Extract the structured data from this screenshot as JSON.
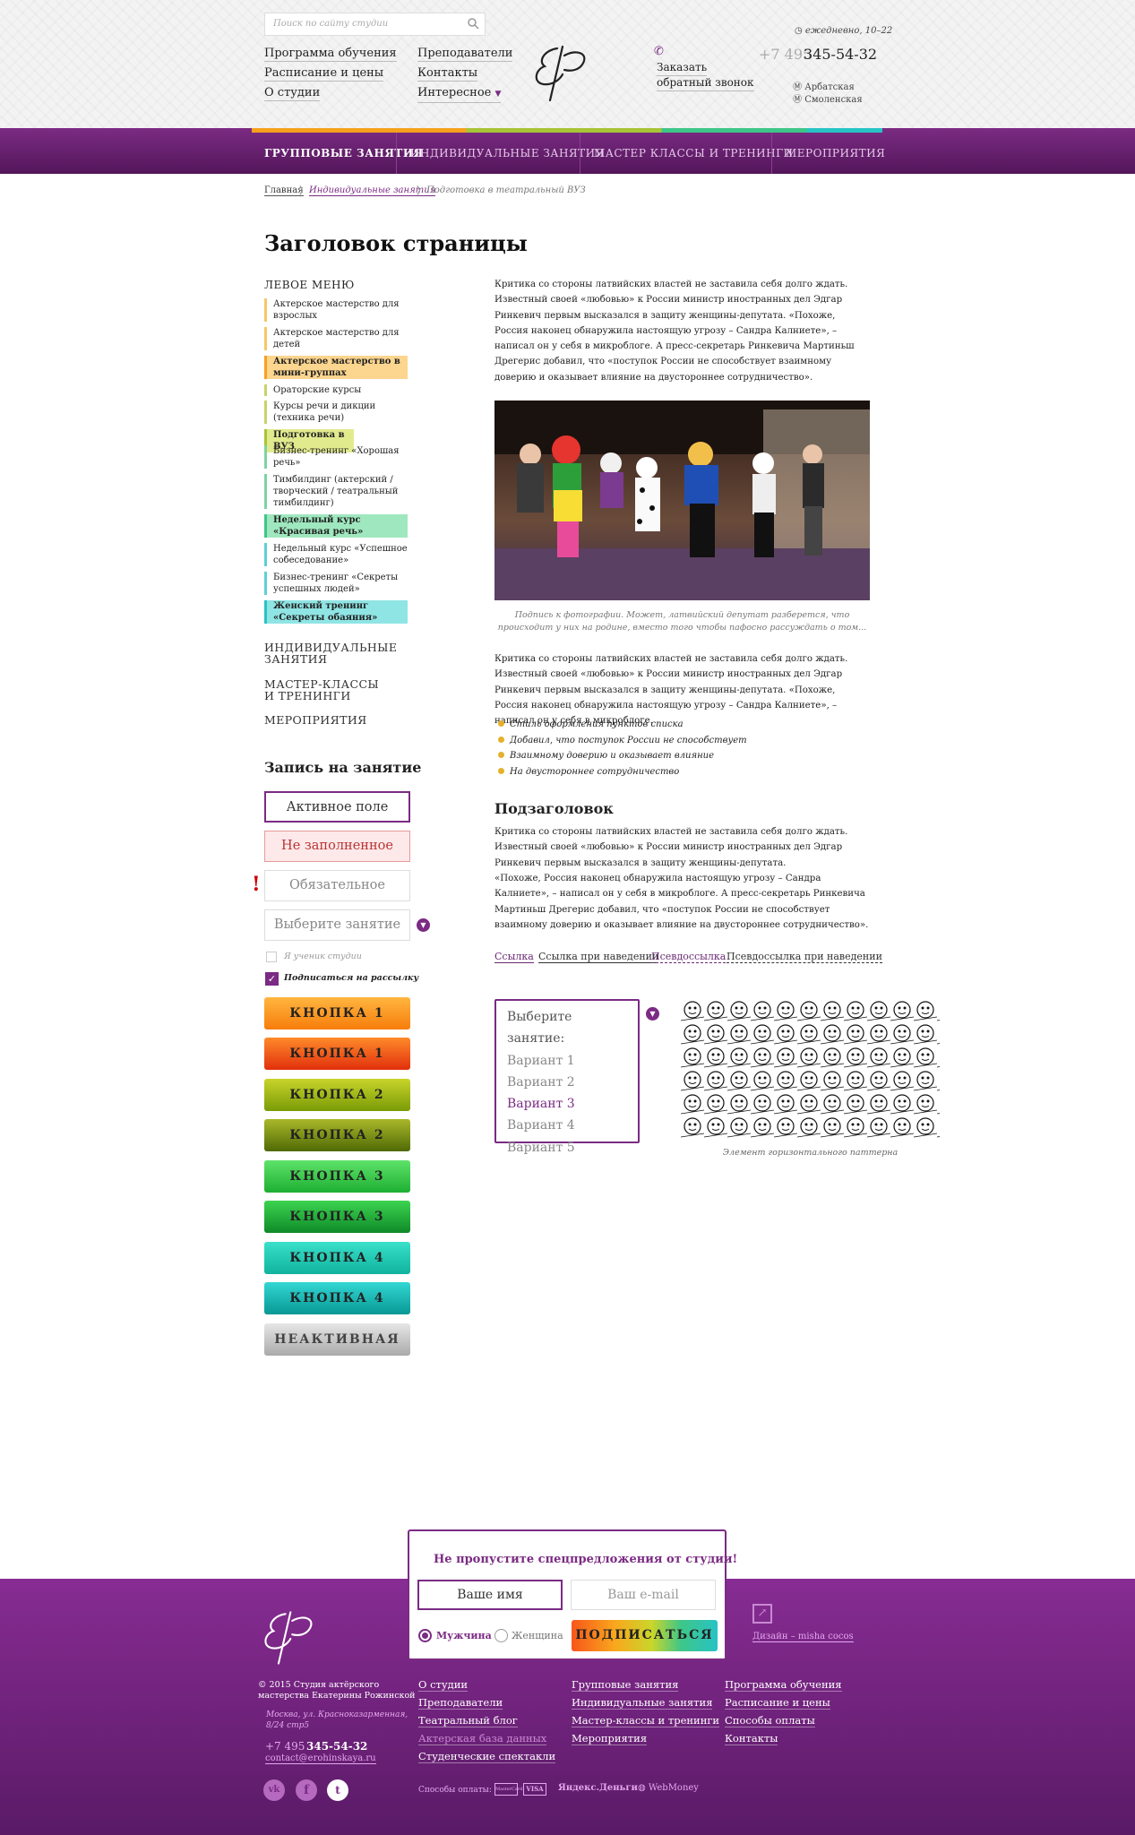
{
  "header": {
    "search_placeholder": "Поиск по сайту студии",
    "links_col1": [
      "Программа обучения",
      "Расписание и цены",
      "О студии"
    ],
    "links_col2": [
      "Преподаватели",
      "Контакты",
      "Интересное"
    ],
    "callback": [
      "Заказать",
      "обратный звонок"
    ],
    "hours": "ежедневно, 10–22",
    "phone_prefix": "+7 495",
    "phone": "345-54-32",
    "metro": [
      "Арбатская",
      "Смоленская"
    ]
  },
  "nav": {
    "items": [
      "Групповые занятия",
      "Индивидуальные занятия",
      "Мастер классы и тренинги",
      "Мероприятия"
    ]
  },
  "breadcrumb": [
    "Главная",
    "Индивидуальные занятия",
    "Подготовка в театральный ВУЗ"
  ],
  "page_title": "Заголовок страницы",
  "left_menu": {
    "title": "ЛЕВОЕ МЕНЮ",
    "items": [
      "Актерское мастерство для взрослых",
      "Актерское мастерство для детей",
      "Актерское мастерство в мини-группах",
      "Ораторские курсы",
      "Курсы речи и дикции (техника речи)",
      "Подготовка в ВУЗ",
      "Бизнес-тренинг «Хорошая речь»",
      "Тимбилдинг (актерский / творческий / театральный тимбилдинг)",
      "Недельный курс «Красивая речь»",
      "Недельный курс «Успешное собеседование»",
      "Бизнес-тренинг «Секреты успешных людей»",
      "Женский тренинг «Секреты обаяния»"
    ],
    "sections": [
      "ИНДИВИДУАЛЬНЫЕ ЗАНЯТИЯ",
      "МАСТЕР-КЛАССЫ И ТРЕНИНГИ",
      "МЕРОПРИЯТИЯ"
    ]
  },
  "form": {
    "title": "Запись на занятие",
    "active": "Активное поле",
    "empty": "Не заполненное",
    "required": "Обязательное",
    "select": "Выберите занятие",
    "check1": "Я ученик студии",
    "check2": "Подписаться на рассылку",
    "buttons": [
      "Кнопка 1",
      "Кнопка 1 roll",
      "Кнопка 2",
      "Кнопка 2 roll",
      "Кнопка 3",
      "Кнопка 3 roll",
      "Кнопка 4",
      "Кнопка 4 roll",
      "Неактивная"
    ]
  },
  "content": {
    "p1": "Критика со стороны латвийских властей не заставила себя долго ждать. Известный своей «любовью» к России министр иностранных дел Эдгар Ринкевич первым высказался в защиту женщины-депутата. «Похоже, Россия наконец обнаружила настоящую угрозу – Сандра Калниете», – написал он у себя в микроблоге. А пресс-секретарь Ринкевича Мартиньш Дрегерис добавил, что «поступок России не способствует взаимному доверию и оказывает влияние на двустороннее сотрудничество».",
    "caption": "Подпись к фотографии. Может, латвийский депутат разберется, что происходит у них на родине, вместо того чтобы пафосно рассуждать о том...",
    "p2": "Критика со стороны латвийских властей не заставила себя долго ждать. Известный своей «любовью» к России министр иностранных дел Эдгар Ринкевич первым высказался в защиту женщины-депутата. «Похоже, Россия наконец обнаружила настоящую угрозу – Сандра Калниете», – написал он у себя в микроблоге.",
    "list": [
      "Стиль оформления пунктов списка",
      "Добавил, что поступок России не способствует",
      "Взаимному доверию и оказывает влияние",
      "На двустороннее сотрудничество"
    ],
    "subtitle": "Подзаголовок",
    "p3a": "Критика со стороны латвийских властей не заставила себя долго ждать. Известный своей «любовью» к России министр иностранных дел Эдгар Ринкевич первым высказался в защиту женщины-депутата.",
    "p3b": "«Похоже, Россия наконец обнаружила настоящую угрозу – Сандра Калниете», – написал он у себя в микроблоге. А пресс-секретарь Ринкевича Мартиньш Дрегерис добавил, что «поступок России не способствует взаимному доверию и оказывает влияние на двустороннее сотрудничество».",
    "links": [
      "Ссылка",
      "Ссылка при наведении",
      "Псевдоссылка",
      "Псевдоссылка при наведении"
    ],
    "dropdown": [
      "Выберите занятие:",
      "Вариант 1",
      "Вариант 2",
      "Вариант 3",
      "Вариант 4",
      "Вариант 5"
    ],
    "pattern_caption": "Элемент горизонтального паттерна"
  },
  "popup": {
    "title": "Не пропустите спецпредложения от студии!",
    "name": "Ваше имя",
    "email": "Ваш e-mail",
    "male": "Мужчина",
    "female": "Женщина",
    "button": "Подписаться"
  },
  "footer": {
    "copyright": "© 2015 Студия актёрского мастерства Екатерины Рожинской",
    "address": "Москва, ул. Красноказарменная, 8/24 стр5",
    "phone_prefix": "+7 495",
    "phone": "345-54-32",
    "email": "contact@erohinskaya.ru",
    "col1": [
      "О студии",
      "Преподаватели",
      "Театральный блог",
      "Актерская база данных",
      "Студенческие спектакли"
    ],
    "col2": [
      "Групповые занятия",
      "Индивидуальные занятия",
      "Мастер-классы и тренинги",
      "Мероприятия"
    ],
    "col3": [
      "Программа обучения",
      "Расписание и цены",
      "Способы оплаты",
      "Контакты"
    ],
    "design": "Дизайн – misha cocos",
    "pay_label": "Способы оплаты:",
    "pay": [
      "MasterCard",
      "VISA",
      "Яндекс.Деньги",
      "WebMoney"
    ]
  },
  "colors": {
    "purple": "#7b2b83",
    "nav_dark": "#53165a",
    "yellow": "#f6a11d",
    "green": "#a8c437",
    "mint": "#3ec688",
    "teal": "#28c3c5"
  }
}
